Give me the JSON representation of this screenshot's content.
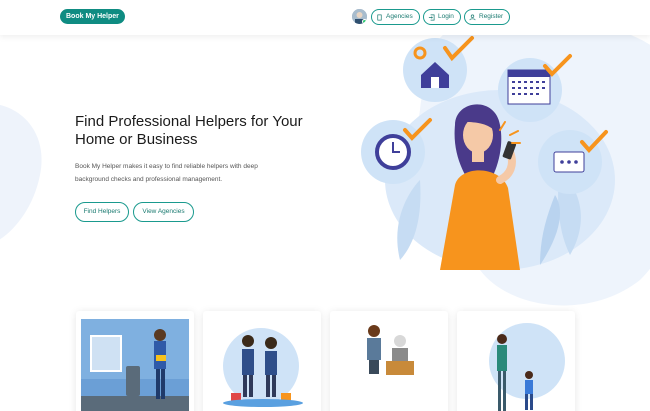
{
  "header": {
    "brand": "Book My Helper",
    "nav": [
      {
        "label": "Agencies",
        "icon": "building-icon"
      },
      {
        "label": "Login",
        "icon": "login-icon"
      },
      {
        "label": "Register",
        "icon": "user-icon"
      }
    ]
  },
  "hero": {
    "title": "Find Professional Helpers for Your Home or Business",
    "description": "Book My Helper makes it easy to find reliable helpers with deep background checks and professional management.",
    "primary_button": "Find Helpers",
    "secondary_button": "View Agencies"
  },
  "colors": {
    "brand": "#0f8c82",
    "accent_orange": "#f7941d",
    "accent_blue": "#cfe3f7"
  }
}
